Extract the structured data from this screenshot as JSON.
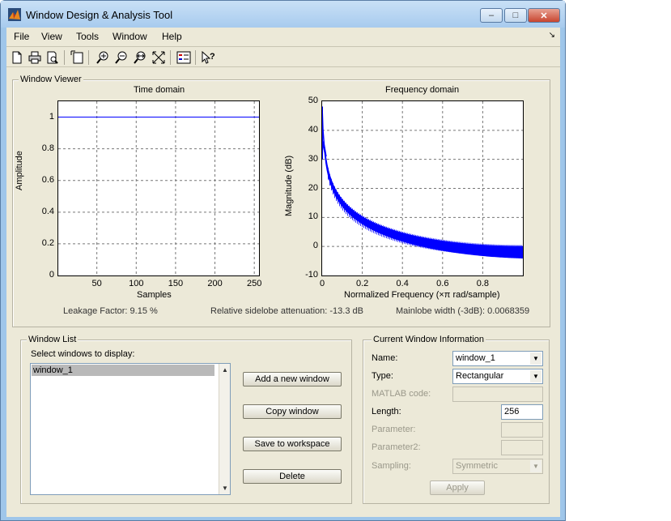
{
  "window": {
    "title": "Window Design & Analysis Tool",
    "minimize": "–",
    "maximize": "□",
    "close": "✕"
  },
  "menu": {
    "items": [
      "File",
      "View",
      "Tools",
      "Window",
      "Help"
    ],
    "dock_arrow": "↘"
  },
  "toolbar": {
    "icons": [
      "new-icon",
      "print-icon",
      "print-preview-icon",
      "new-window-icon",
      "zoom-in-icon",
      "zoom-out-icon",
      "zoom-x-icon",
      "zoom-fit-icon",
      "legend-icon",
      "whats-this-icon"
    ]
  },
  "viewer": {
    "title": "Window Viewer",
    "leakage": "Leakage Factor: 9.15 %",
    "sidelobe": "Relative sidelobe attenuation: -13.3 dB",
    "mainlobe": "Mainlobe width (-3dB): 0.0068359"
  },
  "chart_data": [
    {
      "type": "line",
      "title": "Time domain",
      "xlabel": "Samples",
      "ylabel": "Amplitude",
      "xlim": [
        1,
        256
      ],
      "ylim": [
        0,
        1.1
      ],
      "xticks": [
        "50",
        "100",
        "150",
        "200",
        "250"
      ],
      "yticks": [
        "0",
        "0.2",
        "0.4",
        "0.6",
        "0.8",
        "1"
      ],
      "grid": true,
      "series": [
        {
          "x": [
            1,
            256
          ],
          "y": [
            1,
            1
          ],
          "color": "#0000ff"
        }
      ]
    },
    {
      "type": "line",
      "title": "Frequency domain",
      "xlabel": "Normalized Frequency  (×π rad/sample)",
      "ylabel": "Magnitude (dB)",
      "xlim": [
        0,
        1
      ],
      "ylim": [
        -10,
        50
      ],
      "xticks": [
        "0",
        "0.2",
        "0.4",
        "0.6",
        "0.8"
      ],
      "yticks": [
        "-10",
        "0",
        "10",
        "20",
        "30",
        "40",
        "50"
      ],
      "grid": true,
      "series": [
        {
          "color": "#0000ff",
          "peak_db": 48.2,
          "upper_envelope_db_at_1": -1,
          "lower_envelope_db_at_1": -3
        }
      ]
    }
  ],
  "window_list": {
    "title": "Window List",
    "select_label": "Select windows to display:",
    "items": [
      "window_1"
    ],
    "buttons": [
      "Add a new window",
      "Copy window",
      "Save to workspace",
      "Delete"
    ]
  },
  "current": {
    "title": "Current Window Information",
    "name_label": "Name:",
    "name_value": "window_1",
    "type_label": "Type:",
    "type_value": "Rectangular",
    "matlab_label": "MATLAB code:",
    "matlab_value": "",
    "length_label": "Length:",
    "length_value": "256",
    "param_label": "Parameter:",
    "param_value": "",
    "param2_label": "Parameter2:",
    "param2_value": "",
    "sampling_label": "Sampling:",
    "sampling_value": "Symmetric",
    "apply_label": "Apply"
  }
}
